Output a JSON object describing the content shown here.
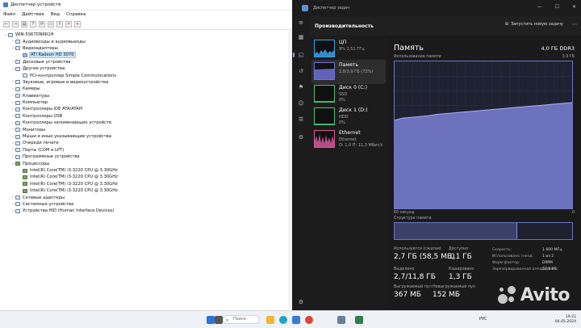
{
  "device_manager": {
    "title": "Диспетчер устройств",
    "menu": [
      "Файл",
      "Действие",
      "Вид",
      "Справка"
    ],
    "toolbar_icons": [
      "back-icon",
      "forward-icon",
      "properties-icon",
      "help-icon",
      "scan-icon",
      "monitor-icon",
      "update-driver-icon",
      "remove-icon",
      "add-icon"
    ],
    "tree": [
      {
        "label": "WIN-5S67DN6R1H",
        "level": 0,
        "exp": "v",
        "icon": "computer-icon"
      },
      {
        "label": "Аудиовходы и аудиовыходы",
        "level": 1,
        "exp": ">",
        "icon": "audio-icon"
      },
      {
        "label": "Видеоадаптеры",
        "level": 1,
        "exp": "v",
        "icon": "display-adapter-icon"
      },
      {
        "label": "ATI Radeon HD 3070",
        "level": 2,
        "exp": "",
        "icon": "gpu-icon",
        "selected": true
      },
      {
        "label": "Дисковые устройства",
        "level": 1,
        "exp": ">",
        "icon": "disk-icon"
      },
      {
        "label": "Другие устройства",
        "level": 1,
        "exp": "v",
        "icon": "other-device-icon"
      },
      {
        "label": "PCI-контроллер Simple Communications",
        "level": 2,
        "exp": "",
        "icon": "pci-icon"
      },
      {
        "label": "Звуковые, игровые и видеоустройства",
        "level": 1,
        "exp": ">",
        "icon": "sound-icon"
      },
      {
        "label": "Камеры",
        "level": 1,
        "exp": ">",
        "icon": "camera-icon"
      },
      {
        "label": "Клавиатуры",
        "level": 1,
        "exp": ">",
        "icon": "keyboard-icon"
      },
      {
        "label": "Компьютер",
        "level": 1,
        "exp": ">",
        "icon": "computer-icon"
      },
      {
        "label": "Контроллеры IDE ATA/ATAPI",
        "level": 1,
        "exp": ">",
        "icon": "ide-icon"
      },
      {
        "label": "Контроллеры USB",
        "level": 1,
        "exp": ">",
        "icon": "usb-icon"
      },
      {
        "label": "Контроллеры запоминающих устройств",
        "level": 1,
        "exp": ">",
        "icon": "storage-icon"
      },
      {
        "label": "Мониторы",
        "level": 1,
        "exp": ">",
        "icon": "monitor-icon"
      },
      {
        "label": "Мыши и иные указывающие устройства",
        "level": 1,
        "exp": ">",
        "icon": "mouse-icon"
      },
      {
        "label": "Очереди печати",
        "level": 1,
        "exp": ">",
        "icon": "printer-icon"
      },
      {
        "label": "Порты (COM и LPT)",
        "level": 1,
        "exp": ">",
        "icon": "port-icon"
      },
      {
        "label": "Программные устройства",
        "level": 1,
        "exp": ">",
        "icon": "software-device-icon"
      },
      {
        "label": "Процессоры",
        "level": 1,
        "exp": "v",
        "icon": "cpu-icon"
      },
      {
        "label": "Intel(R) Core(TM) i3-3220 CPU @ 3.30GHz",
        "level": 2,
        "exp": "",
        "icon": "cpu-icon"
      },
      {
        "label": "Intel(R) Core(TM) i3-3220 CPU @ 3.30GHz",
        "level": 2,
        "exp": "",
        "icon": "cpu-icon"
      },
      {
        "label": "Intel(R) Core(TM) i3-3220 CPU @ 3.30GHz",
        "level": 2,
        "exp": "",
        "icon": "cpu-icon"
      },
      {
        "label": "Intel(R) Core(TM) i3-3220 CPU @ 3.30GHz",
        "level": 2,
        "exp": "",
        "icon": "cpu-icon"
      },
      {
        "label": "Сетевые адаптеры",
        "level": 1,
        "exp": ">",
        "icon": "network-adapter-icon"
      },
      {
        "label": "Системные устройства",
        "level": 1,
        "exp": ">",
        "icon": "system-device-icon"
      },
      {
        "label": "Устройства HID (Human Interface Devices)",
        "level": 1,
        "exp": ">",
        "icon": "hid-icon"
      }
    ]
  },
  "task_manager": {
    "title": "Диспетчер задач",
    "header": {
      "title": "Производительность",
      "new_task": "Запустить новую задачу"
    },
    "rail_icons": [
      "menu-icon",
      "processes-icon",
      "performance-icon",
      "history-icon",
      "startup-icon",
      "users-icon",
      "details-icon",
      "services-icon",
      "settings-icon"
    ],
    "cards": [
      {
        "name": "ЦП",
        "line1": "9% 2,51 ГГц",
        "line2": "",
        "color": "#3aa0e6",
        "kind": "cpu"
      },
      {
        "name": "Память",
        "line1": "2,8/3,9 ГБ (72%)",
        "line2": "",
        "color": "#6f72d6",
        "kind": "mem",
        "active": true
      },
      {
        "name": "Диск 0 (C:)",
        "line1": "SSD",
        "line2": "0%",
        "color": "#4fc27c",
        "kind": "disk"
      },
      {
        "name": "Диск 1 (D:)",
        "line1": "HDD",
        "line2": "0%",
        "color": "#4fc27c",
        "kind": "disk2"
      },
      {
        "name": "Ethernet",
        "line1": "Ethernet",
        "line2": "О: 1,0  П: 11,3 Мбит/с",
        "color": "#d45a9a",
        "kind": "eth"
      }
    ],
    "memory": {
      "title": "Память",
      "spec": "4,0 ГБ DDR3",
      "usage_label": "Использование памяти",
      "max_label": "3,9 ГБ",
      "time_left": "60 секунд",
      "time_right": "0",
      "zero_label": "0",
      "structure_label": "Структура памяти",
      "structure_used_fraction": 0.685,
      "history": [
        0.6,
        0.615,
        0.62,
        0.625,
        0.63,
        0.64,
        0.645,
        0.65,
        0.655,
        0.66,
        0.665,
        0.67,
        0.675,
        0.68,
        0.685,
        0.69,
        0.695,
        0.7,
        0.705,
        0.71,
        0.715,
        0.72
      ],
      "stats": [
        {
          "label": "Используется (сжатая)",
          "value": "2,7 ГБ (58,5 МБ)"
        },
        {
          "label": "Доступно",
          "value": "1,1 ГБ"
        },
        {
          "label": "Выделено",
          "value": "2,7/11,8 ГБ"
        },
        {
          "label": "Кэшировано",
          "value": "1,3 ГБ"
        },
        {
          "label": "Выгружаемый пул",
          "value": "367 МБ"
        },
        {
          "label": "Невыгружаемый пул",
          "value": "152 МБ"
        }
      ],
      "props": [
        {
          "k": "Скорость:",
          "v": "1 600 МГц"
        },
        {
          "k": "Использовано гнезд:",
          "v": "1 из 2"
        },
        {
          "k": "Форм-фактор:",
          "v": "DIMM"
        },
        {
          "k": "Зарезервированная аппаратно:",
          "v": "53,8 МБ"
        }
      ]
    }
  },
  "taskbar": {
    "search_placeholder": "Поиск",
    "lang": "РУС",
    "time": "19:21",
    "date": "04.05.2024",
    "icons": [
      {
        "name": "start-icon",
        "color": "#2b74d8"
      },
      {
        "name": "task-view-icon",
        "color": "#555555"
      },
      {
        "name": "explorer-icon",
        "color": "#f2b632"
      },
      {
        "name": "edge-icon",
        "color": "#1fa3c9"
      },
      {
        "name": "store-icon",
        "color": "#3a7bd5"
      },
      {
        "name": "chrome-icon",
        "color": "#db4437"
      },
      {
        "name": "device-manager-icon",
        "color": "#6b7f9a"
      },
      {
        "name": "task-manager-icon",
        "color": "#2f7d4a"
      }
    ]
  },
  "watermark": {
    "text": "Avito"
  }
}
